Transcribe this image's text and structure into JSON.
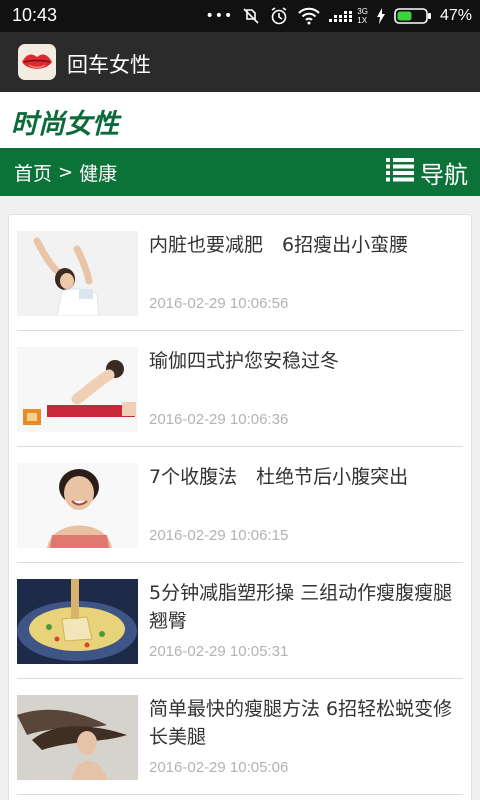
{
  "status_bar": {
    "time": "10:43",
    "signal_text_top": "3G",
    "signal_text_bottom": "1X",
    "battery": "47%"
  },
  "app_bar": {
    "title": "回车女性",
    "icon": "lips-icon"
  },
  "site": {
    "logo": "时尚女性"
  },
  "nav": {
    "home": "首页",
    "separator": ">",
    "current": "健康",
    "menu_label": "导航"
  },
  "articles": [
    {
      "title": "内脏也要减肥　6招瘦出小蛮腰",
      "time": "2016-02-29 10:06:56"
    },
    {
      "title": "瑜伽四式护您安稳过冬",
      "time": "2016-02-29 10:06:36"
    },
    {
      "title": "7个收腹法　杜绝节后小腹突出",
      "time": "2016-02-29 10:06:15"
    },
    {
      "title": "5分钟减脂塑形操 三组动作瘦腹瘦腿翘臀",
      "time": "2016-02-29 10:05:31"
    },
    {
      "title": "简单最快的瘦腿方法 6招轻松蜕变修长美腿",
      "time": "2016-02-29 10:05:06"
    }
  ],
  "colors": {
    "accent_green": "#0b7238",
    "logo_green": "#0c6b3a",
    "app_bar": "#2b2b2b"
  }
}
